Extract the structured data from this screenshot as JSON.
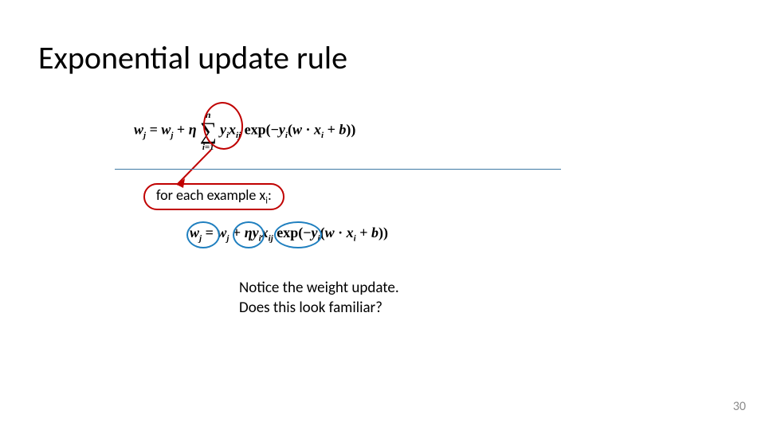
{
  "title": "Exponential update rule",
  "page_number": "30",
  "eq1": {
    "lhs": "w",
    "lhs_sub": "j",
    "eq": " = ",
    "rhs1": "w",
    "rhs1_sub": "j",
    "plus": " + ",
    "eta": "η",
    "sum_top": "n",
    "sum_bottom": "i=1",
    "y": "y",
    "y_sub": "i",
    "x": "x",
    "x_sub": "ij",
    "exp_prefix": " exp(−",
    "y2": "y",
    "y2_sub": "i",
    "open": "(",
    "w": "w",
    "dot": " · ",
    "xi": "x",
    "xi_sub": "i",
    "plus_b": " + ",
    "b": "b",
    "close": "))"
  },
  "caption": {
    "text_a": "for each example x",
    "sub": "i",
    "text_b": ":"
  },
  "eq2": {
    "lhs": "w",
    "lhs_sub": "j",
    "eq": " = ",
    "rhs1": "w",
    "rhs1_sub": "j",
    "plus": " + ",
    "eta": "η",
    "y": "y",
    "y_sub": "i",
    "x": "x",
    "x_sub": "ij",
    "exp_prefix": " exp(−",
    "y2": "y",
    "y2_sub": "i",
    "open": "(",
    "w": "w",
    "dot": " · ",
    "xi": "x",
    "xi_sub": "i",
    "plus_b": " + ",
    "b": "b",
    "close": "))"
  },
  "notice": {
    "line1": "Notice the weight update.",
    "line2": "Does this look familiar?"
  }
}
